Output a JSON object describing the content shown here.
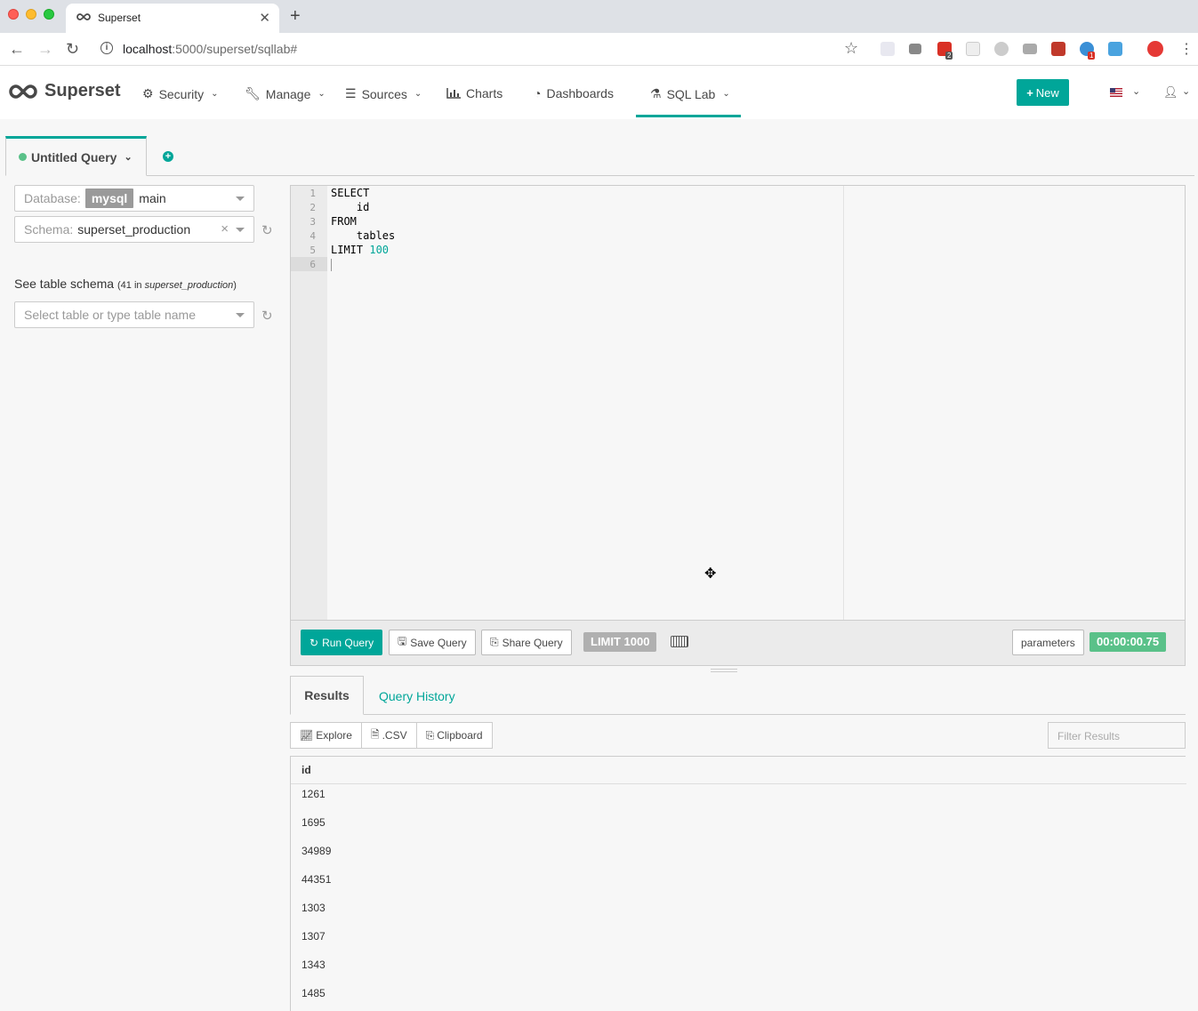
{
  "browser": {
    "tab_title": "Superset",
    "url_host": "localhost",
    "url_path": ":5000/superset/sqllab#",
    "ext_badges": [
      "2",
      "1"
    ]
  },
  "navbar": {
    "brand": "Superset",
    "items": [
      {
        "label": "Security",
        "icon": "cogs-icon"
      },
      {
        "label": "Manage",
        "icon": "wrench-icon"
      },
      {
        "label": "Sources",
        "icon": "database-icon"
      },
      {
        "label": "Charts",
        "icon": "bar-chart-icon"
      },
      {
        "label": "Dashboards",
        "icon": "dashboard-icon"
      },
      {
        "label": "SQL Lab",
        "icon": "flask-icon"
      }
    ],
    "new_label": "New",
    "accent": "#00a699"
  },
  "query_tabs": {
    "active_label": "Untitled Query"
  },
  "left_panel": {
    "database_prefix": "Database:",
    "database_chip": "mysql",
    "database_value": "main",
    "schema_prefix": "Schema:",
    "schema_value": "superset_production",
    "schema_title": "See table schema",
    "schema_count": "41",
    "schema_in": "in",
    "schema_name": "superset_production",
    "table_placeholder": "Select table or type table name"
  },
  "editor": {
    "line_numbers": [
      "1",
      "2",
      "3",
      "4",
      "5",
      "6"
    ],
    "lines": [
      "SELECT",
      "    id",
      "FROM",
      "    tables",
      "LIMIT "
    ],
    "limit_number": "100"
  },
  "toolbar": {
    "run_label": "Run Query",
    "save_label": "Save Query",
    "share_label": "Share Query",
    "limit_label": "LIMIT 1000",
    "parameters_label": "parameters",
    "timer": "00:00:00.75"
  },
  "results": {
    "tabs": [
      "Results",
      "Query History"
    ],
    "actions": [
      "Explore",
      ".CSV",
      "Clipboard"
    ],
    "filter_placeholder": "Filter Results",
    "column": "id",
    "rows": [
      "1261",
      "1695",
      "34989",
      "44351",
      "1303",
      "1307",
      "1343",
      "1485"
    ]
  }
}
